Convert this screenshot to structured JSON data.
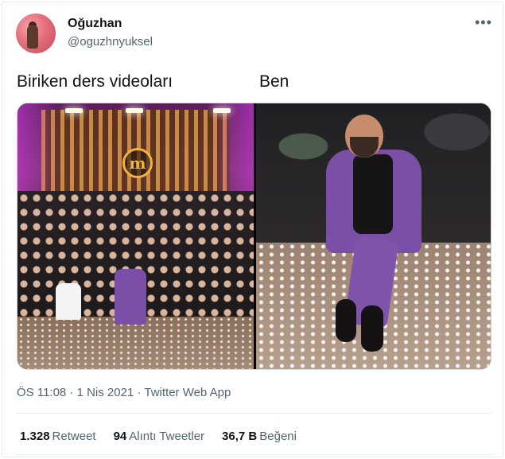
{
  "tweet": {
    "author": {
      "name": "Oğuzhan",
      "handle": "@oguzhnyuksel"
    },
    "more_icon": "•••",
    "captions": {
      "left": "Biriken ders videoları",
      "right": "Ben"
    },
    "media": {
      "left_logo_letter": "m"
    },
    "timestamp": "ÖS 11:08 · 1 Nis 2021 · Twitter Web App",
    "stats": [
      {
        "count": "1.328",
        "label": "Retweet"
      },
      {
        "count": "94",
        "label": "Alıntı Tweetler"
      },
      {
        "count": "36,7 B",
        "label": "Beğeni"
      }
    ]
  },
  "colors": {
    "text_primary": "#0f1419",
    "text_secondary": "#536471",
    "border": "#e6ecf0"
  }
}
